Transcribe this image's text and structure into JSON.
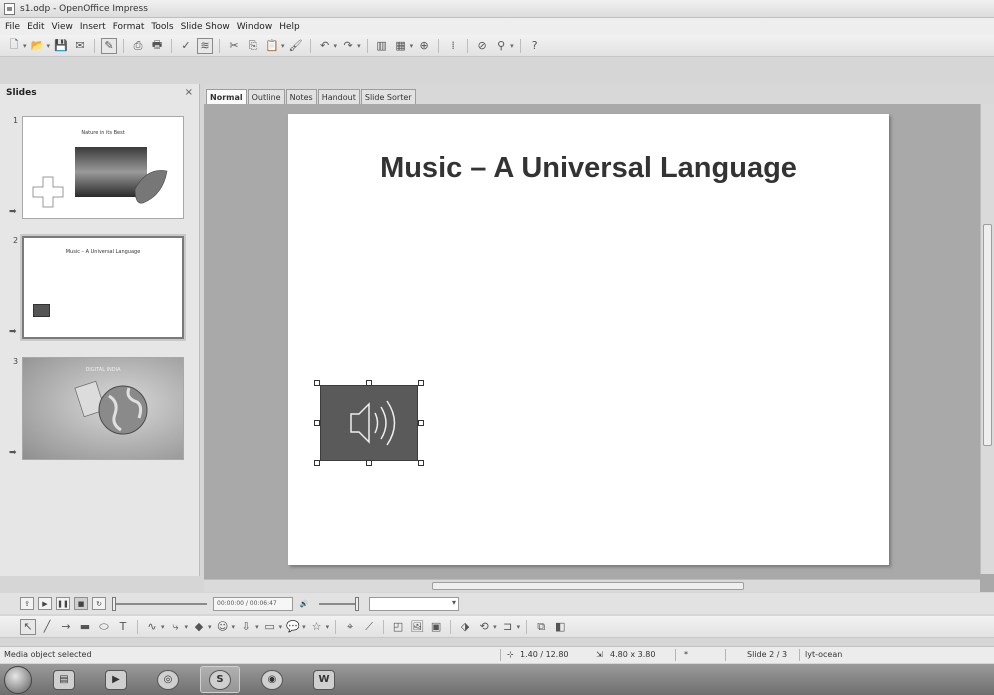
{
  "window": {
    "title": "s1.odp - OpenOffice Impress"
  },
  "menu": [
    "File",
    "Edit",
    "View",
    "Insert",
    "Format",
    "Tools",
    "Slide Show",
    "Window",
    "Help"
  ],
  "slides_panel": {
    "title": "Slides",
    "close": "×",
    "slides": [
      {
        "num": "1",
        "title": "Nature in its Best"
      },
      {
        "num": "2",
        "title": "Music – A Universal Language"
      },
      {
        "num": "3",
        "title": "DIGITAL INDIA"
      }
    ]
  },
  "view_tabs": [
    "Normal",
    "Outline",
    "Notes",
    "Handout",
    "Slide Sorter"
  ],
  "slide": {
    "title": "Music – A Universal Language"
  },
  "media_bar": {
    "time": "00:00:00 / 00:06:47"
  },
  "status": {
    "message": "Media object selected",
    "position": "1.40 / 12.80",
    "size": "4.80 x 3.80",
    "slide": "Slide 2 / 3",
    "layout": "lyt-ocean"
  },
  "colors": {
    "media_object": "#5a5a5a",
    "work_area": "#a9a9a9"
  }
}
